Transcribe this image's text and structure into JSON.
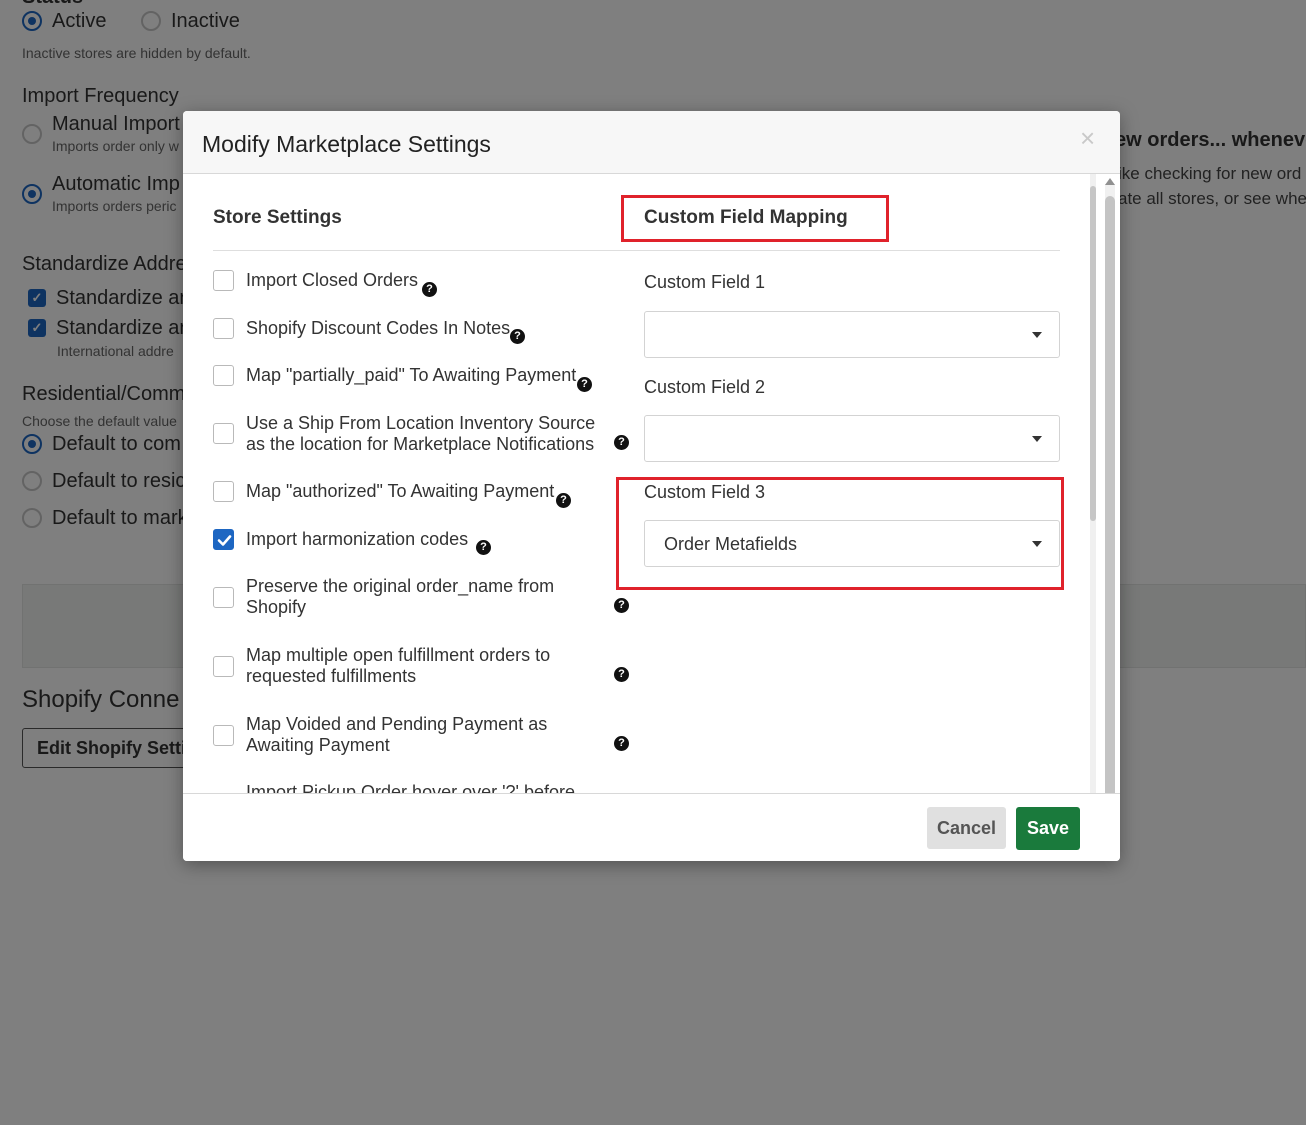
{
  "background": {
    "status": {
      "heading": "Status",
      "active_label": "Active",
      "inactive_label": "Inactive",
      "hint": "Inactive stores are hidden by default."
    },
    "import_frequency": {
      "heading": "Import Frequency",
      "manual_label": "Manual Import",
      "manual_sub": "Imports order only w",
      "auto_label": "Automatic Imp",
      "auto_sub": "Imports orders peric"
    },
    "right_text": {
      "title": "ew orders... whenever",
      "line1": "ike checking for new ord",
      "line2": "ate all stores, or see whe"
    },
    "standardize": {
      "heading": "Standardize Addre",
      "opt1": "Standardize ar",
      "opt2": "Standardize ar",
      "opt2_sub": "International addre"
    },
    "residential": {
      "heading": "Residential/Comm",
      "hint": "Choose the default value",
      "opt1": "Default to com",
      "opt2": "Default to resic",
      "opt3": "Default to mark"
    },
    "shopify": {
      "heading": "Shopify Conne",
      "button": "Edit Shopify Settin"
    }
  },
  "modal": {
    "title": "Modify Marketplace Settings",
    "close_glyph": "×",
    "store_settings_heading": "Store Settings",
    "custom_field_heading": "Custom Field Mapping",
    "options": [
      {
        "label": "Import Closed Orders",
        "checked": false
      },
      {
        "label": "Shopify Discount Codes In Notes",
        "checked": false
      },
      {
        "label": "Map \"partially_paid\" To Awaiting Payment",
        "checked": false
      },
      {
        "label": "Use a Ship From Location Inventory Source as the location for Marketplace Notifications",
        "checked": false
      },
      {
        "label": "Map \"authorized\" To Awaiting Payment",
        "checked": false
      },
      {
        "label": "Import harmonization codes",
        "checked": true
      },
      {
        "label": "Preserve the original order_name from Shopify",
        "checked": false
      },
      {
        "label": "Map multiple open fulfillment orders to requested fulfillments",
        "checked": false
      },
      {
        "label": "Map Voided and Pending Payment as Awaiting Payment",
        "checked": false
      },
      {
        "label": "Import Pickup Order hover over '?' before",
        "checked": false
      }
    ],
    "custom_fields": [
      {
        "label": "Custom Field 1",
        "value": ""
      },
      {
        "label": "Custom Field 2",
        "value": ""
      },
      {
        "label": "Custom Field 3",
        "value": "Order Metafields"
      }
    ],
    "help_glyph": "?",
    "cancel_label": "Cancel",
    "save_label": "Save"
  },
  "colors": {
    "accent": "#1d66c2",
    "save": "#1a7a3c",
    "highlight": "#e0222b"
  }
}
